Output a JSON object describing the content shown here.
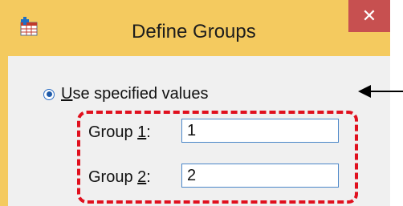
{
  "window": {
    "title": "Define Groups",
    "icon": "define-groups-app-icon",
    "close_glyph": "✕"
  },
  "options": {
    "specified_values": {
      "label_prefix": "",
      "label_mnemonic": "U",
      "label_rest": "se specified values",
      "selected": true
    }
  },
  "groups": [
    {
      "label_prefix": "Group ",
      "label_mnemonic": "1",
      "label_suffix": ":",
      "value": "1"
    },
    {
      "label_prefix": "Group ",
      "label_mnemonic": "2",
      "label_suffix": ":",
      "value": "2"
    }
  ],
  "annotations": {
    "highlight_color": "#e0101e",
    "arrow_color": "#000000"
  },
  "colors": {
    "title_bar": "#f4ca5f",
    "close_button": "#c75050",
    "client_area": "#f0f0f0",
    "input_border": "#4a86c8"
  }
}
